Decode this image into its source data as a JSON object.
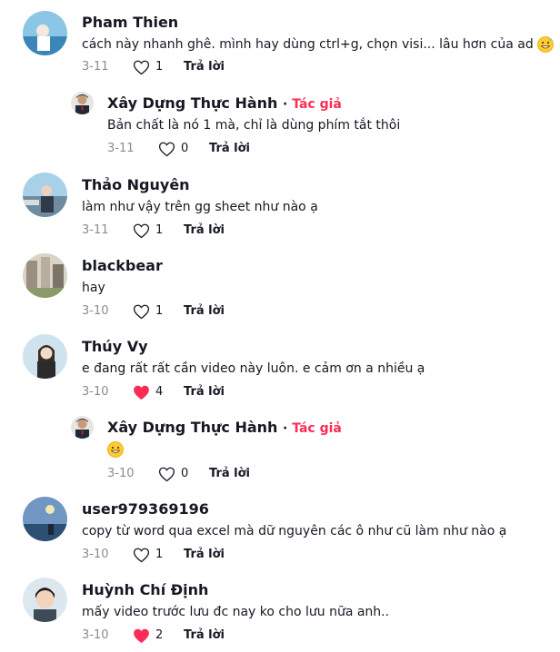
{
  "colors": {
    "author_badge": "#fe2c55",
    "liked_heart": "#fe2c55",
    "muted_text": "#8a8b91"
  },
  "comments": [
    {
      "username": "Pham Thien",
      "text": "cách này nhanh ghê. mình hay dùng ctrl+g, chọn visi... lâu hơn của ad",
      "emoji": "grinning-sweat-emoji",
      "date": "3-11",
      "likes": "1",
      "liked": false,
      "reply_label": "Trả lời"
    },
    {
      "username": "Xây Dựng Thực Hành",
      "author_badge": "Tác giả",
      "text": "Bản chất là nó 1 mà, chỉ là dùng phím tắt thôi",
      "date": "3-11",
      "likes": "0",
      "liked": false,
      "reply_label": "Trả lời"
    },
    {
      "username": "Thảo Nguyên",
      "text": "làm như vậy trên gg sheet như nào ạ",
      "date": "3-11",
      "likes": "1",
      "liked": false,
      "reply_label": "Trả lời"
    },
    {
      "username": "blackbear",
      "text": "hay",
      "date": "3-10",
      "likes": "1",
      "liked": false,
      "reply_label": "Trả lời"
    },
    {
      "username": "Thúy Vy",
      "text": "e đang rất rất cần video này luôn. e cảm ơn a nhiều ạ",
      "date": "3-10",
      "likes": "4",
      "liked": true,
      "reply_label": "Trả lời"
    },
    {
      "username": "Xây Dựng Thực Hành",
      "author_badge": "Tác giả",
      "text": "",
      "emoji": "grinning-emoji",
      "date": "3-10",
      "likes": "0",
      "liked": false,
      "reply_label": "Trả lời"
    },
    {
      "username": "user979369196",
      "text": "copy từ word qua excel mà dữ nguyên các ô như cũ làm như nào ạ",
      "date": "3-10",
      "likes": "1",
      "liked": false,
      "reply_label": "Trả lời"
    },
    {
      "username": "Huỳnh Chí Định",
      "text": "mấy video trước lưu đc nay ko cho lưu nữa anh..",
      "date": "3-10",
      "likes": "2",
      "liked": true,
      "reply_label": "Trả lời"
    }
  ]
}
